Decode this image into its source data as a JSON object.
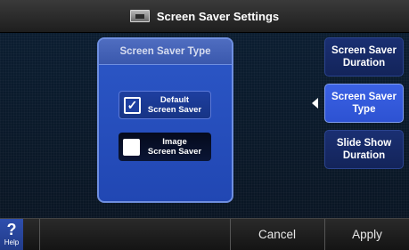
{
  "title": {
    "text": "Screen Saver Settings",
    "icon": "screen-icon"
  },
  "panel": {
    "header": "Screen Saver Type",
    "options": [
      {
        "label_line1": "Default",
        "label_line2": "Screen Saver",
        "checked": true,
        "check_glyph": "✓"
      },
      {
        "label_line1": "Image",
        "label_line2": "Screen Saver",
        "checked": false,
        "check_glyph": ""
      }
    ]
  },
  "side_menu": {
    "items": [
      {
        "line1": "Screen Saver",
        "line2": "Duration",
        "active": false
      },
      {
        "line1": "Screen Saver",
        "line2": "Type",
        "active": true
      },
      {
        "line1": "Slide Show",
        "line2": "Duration",
        "active": false
      }
    ]
  },
  "bottom_bar": {
    "help_symbol": "?",
    "help_label": "Help",
    "cancel_label": "Cancel",
    "apply_label": "Apply"
  },
  "colors": {
    "accent": "#2d52d2",
    "panel": "#2147b3",
    "background": "#0a1a2b"
  }
}
